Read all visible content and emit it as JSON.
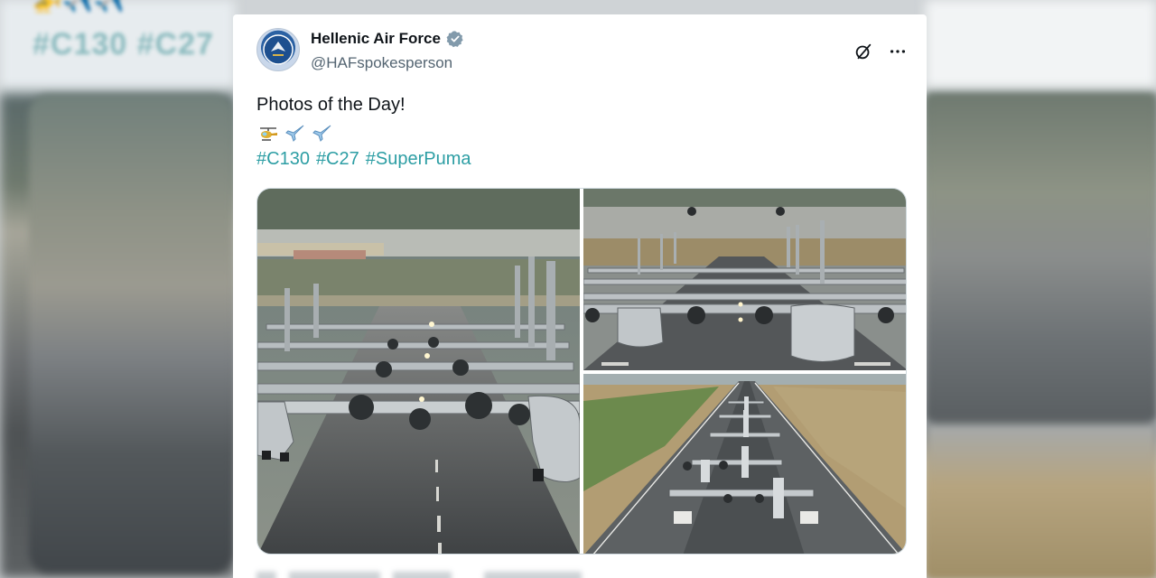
{
  "background": {
    "left_hashtags": "#C130 #C27",
    "left_emoji": "🚁✈️✈️"
  },
  "tweet": {
    "author": {
      "display_name": "Hellenic Air Force",
      "handle": "@HAFspokesperson",
      "verified": true,
      "avatar_icon": "air-force-emblem-icon"
    },
    "text": "Photos of the Day!",
    "emoji": [
      "helicopter",
      "airplane",
      "airplane"
    ],
    "hashtags": [
      "#C130",
      "#C27",
      "#SuperPuma"
    ],
    "hashtag_color": "#2d9ea4",
    "actions": {
      "grok_icon": "grok-icon",
      "more_icon": "more-icon"
    },
    "media": [
      {
        "description": "C-130 aircraft lined up on runway, front view"
      },
      {
        "description": "Row of C-130 aircraft with helicopters above"
      },
      {
        "description": "Aerial view of aircraft taxiing on runway"
      }
    ]
  },
  "colors": {
    "text_primary": "#0f1419",
    "text_secondary": "#536471",
    "verified_badge": "#829aab"
  }
}
